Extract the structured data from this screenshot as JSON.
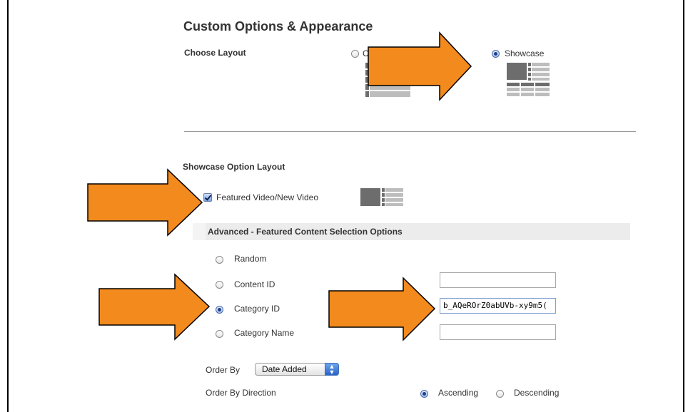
{
  "title": "Custom Options & Appearance",
  "layout": {
    "label": "Choose Layout",
    "options": [
      {
        "label": "C",
        "selected": false
      },
      {
        "label": "Showcase",
        "selected": true
      }
    ]
  },
  "showcase": {
    "label": "Showcase Option Layout",
    "featured_label": "Featured Video/New Video",
    "featured_checked": true
  },
  "advanced": {
    "title": "Advanced - Featured Content Selection Options",
    "options": [
      {
        "label": "Random",
        "selected": false
      },
      {
        "label": "Content ID",
        "selected": false
      },
      {
        "label": "Category ID",
        "selected": true
      },
      {
        "label": "Category Name",
        "selected": false
      }
    ],
    "content_id_value": "",
    "category_id_value": "b_AQeROrZ0abUVb-xy9m5(",
    "category_name_value": ""
  },
  "order_by": {
    "label": "Order By",
    "selected": "Date Added"
  },
  "order_direction": {
    "label": "Order By Direction",
    "options": [
      {
        "label": "Ascending",
        "selected": true
      },
      {
        "label": "Descending",
        "selected": false
      }
    ]
  },
  "colors": {
    "arrow_fill": "#f28a1e",
    "arrow_stroke": "#000000",
    "radio_selected": "#1f3f86"
  },
  "icons": [
    "list-layout-thumbnail-icon",
    "showcase-layout-thumbnail-icon",
    "featured-video-thumbnail-icon",
    "orange-arrow-icon",
    "select-arrows-icon"
  ]
}
